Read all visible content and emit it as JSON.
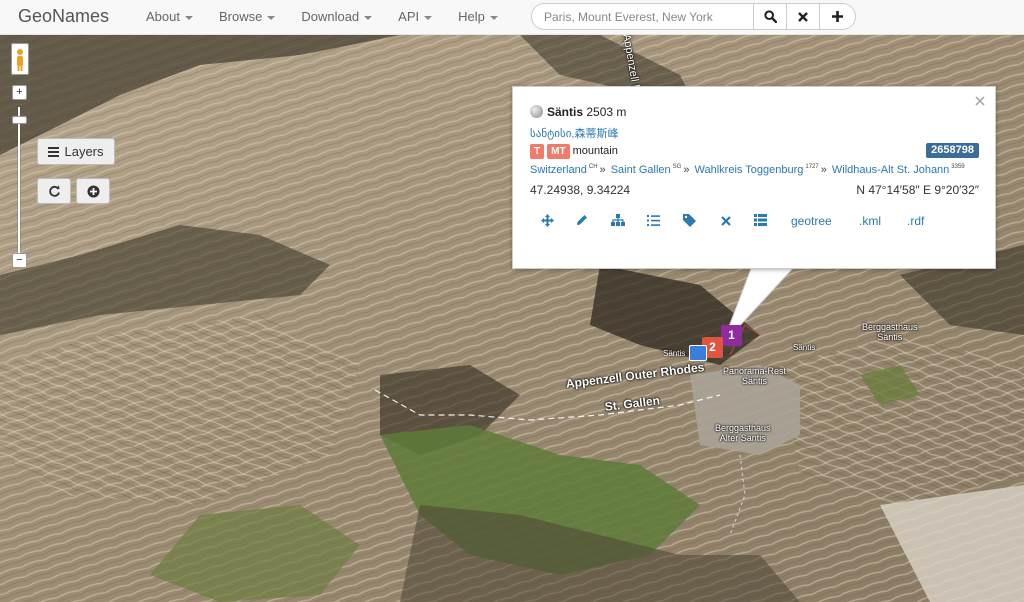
{
  "navbar": {
    "brand": "GeoNames",
    "menu": [
      "About",
      "Browse",
      "Download",
      "API",
      "Help"
    ],
    "search_placeholder": "Paris, Mount Everest, New York"
  },
  "map_controls": {
    "zoom_in": "+",
    "zoom_out": "−",
    "layers_label": "Layers"
  },
  "popup": {
    "name": "Säntis",
    "elevation": "2503 m",
    "alt_names": "სანტისი,森蒂斯峰",
    "feature_class": "T",
    "feature_code": "MT",
    "feature_type": "mountain",
    "geonameid": "2658798",
    "hierarchy": [
      {
        "name": "Switzerland",
        "code": "CH"
      },
      {
        "name": "Saint Gallen",
        "code": "SG"
      },
      {
        "name": "Wahlkreis Toggenburg",
        "code": "1727"
      },
      {
        "name": "Wildhaus-Alt St. Johann",
        "code": "3359"
      }
    ],
    "coords": "47.24938, 9.34224",
    "dms": "N 47°14′58″ E 9°20′32″",
    "actions": {
      "icons": [
        "move-icon",
        "edit-icon",
        "hierarchy-icon",
        "list-icon",
        "tag-icon",
        "delete-icon",
        "table-icon"
      ],
      "geotree": "geotree",
      "kml": ".kml",
      "rdf": ".rdf"
    }
  },
  "markers": [
    {
      "label": "1",
      "color": "#8e2d9e"
    },
    {
      "label": "2",
      "color": "#e0553f"
    }
  ],
  "map_labels": {
    "region1": "Appenzell Outer Rhodes",
    "region2": "St. Gallen",
    "region_top": "Appenzell Inner Rhodes",
    "peak": "Säntis",
    "peak2": "Säntis",
    "panorama": "Panorama-Rest Säntis",
    "panorama_l1": "Panorama-Rest",
    "panorama_l2": "Säntis",
    "berg1_l1": "Berggasthaus",
    "berg1_l2": "Säntis",
    "berg2_l1": "Berggasthaus",
    "berg2_l2": "Alter Säntis"
  }
}
